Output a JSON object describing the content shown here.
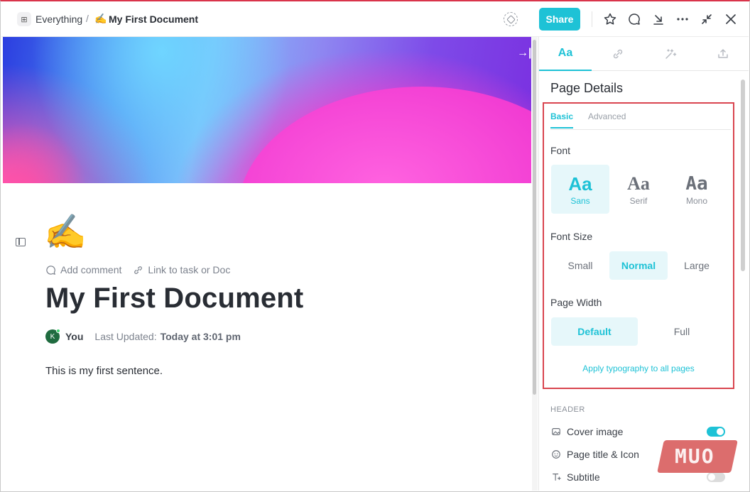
{
  "breadcrumb": {
    "space": "Everything",
    "separator": "/",
    "doc_emoji": "✍️",
    "doc_name": "My First Document"
  },
  "toolbar": {
    "share_label": "Share",
    "accent_color": "#1ec2d6"
  },
  "document": {
    "emoji": "✍️",
    "add_comment": "Add comment",
    "link_task": "Link to task or Doc",
    "title": "My First Document",
    "author_initial": "K",
    "author": "You",
    "updated_label": "Last Updated:",
    "updated_value": "Today at 3:01 pm",
    "body": "This is my first sentence."
  },
  "panel": {
    "tabs": [
      {
        "label": "Aa",
        "icon": "typography-icon",
        "active": true
      },
      {
        "label": "",
        "icon": "link-icon",
        "active": false
      },
      {
        "label": "",
        "icon": "sparkles-icon",
        "active": false
      },
      {
        "label": "",
        "icon": "export-icon",
        "active": false
      }
    ],
    "title": "Page Details",
    "subtabs": {
      "basic": "Basic",
      "advanced": "Advanced"
    },
    "font": {
      "label": "Font",
      "options": [
        {
          "sample": "Aa",
          "name": "Sans",
          "selected": true
        },
        {
          "sample": "Aa",
          "name": "Serif",
          "selected": false
        },
        {
          "sample": "Aa",
          "name": "Mono",
          "selected": false
        }
      ]
    },
    "font_size": {
      "label": "Font Size",
      "options": [
        {
          "name": "Small",
          "selected": false
        },
        {
          "name": "Normal",
          "selected": true
        },
        {
          "name": "Large",
          "selected": false
        }
      ]
    },
    "page_width": {
      "label": "Page Width",
      "options": [
        {
          "name": "Default",
          "selected": true
        },
        {
          "name": "Full",
          "selected": false
        }
      ]
    },
    "apply_link": "Apply typography to all pages",
    "header_section": {
      "label": "HEADER",
      "rows": [
        {
          "label": "Cover image",
          "icon": "image-icon",
          "on": true
        },
        {
          "label": "Page title & Icon",
          "icon": "smiley-icon",
          "on": true
        },
        {
          "label": "Subtitle",
          "icon": "text-icon",
          "on": false
        }
      ]
    }
  },
  "watermark": "MUO"
}
